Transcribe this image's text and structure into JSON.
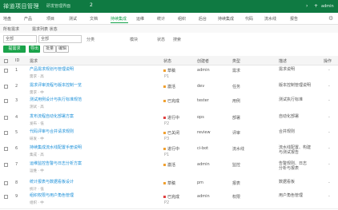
{
  "header": {
    "logo": "禅道项目管理",
    "system_name": "研发管理界面",
    "badge": "2",
    "right_icon_1": "›",
    "right_icon_2": "+",
    "user": "admin",
    "brand_color": "#0f7a42"
  },
  "menu": {
    "items": [
      {
        "label": "地盘"
      },
      {
        "label": "产品"
      },
      {
        "label": "项目"
      },
      {
        "label": "测试"
      },
      {
        "label": "文档"
      },
      {
        "label": "持续集成"
      },
      {
        "label": "运维"
      },
      {
        "label": "统计"
      },
      {
        "label": "组织"
      },
      {
        "label": "后台"
      },
      {
        "label": "持续集成"
      },
      {
        "label": "代码"
      },
      {
        "label": "流水线"
      },
      {
        "label": "报告"
      }
    ],
    "active_index": 5
  },
  "tabs": {
    "left": "所有需求",
    "right": "需求列表 状态"
  },
  "filters": {
    "select_1": "全部",
    "select_2": "全部",
    "text_1": "分类",
    "text_2": "模块",
    "text_3": "状态",
    "text_4": "搜索"
  },
  "buttons": {
    "primary": "提需求",
    "secondary": "导出",
    "outline_1": "批量",
    "outline_2": "编辑"
  },
  "table": {
    "headers": [
      "ID",
      "需求",
      "状态",
      "创建者",
      "类型",
      "描述",
      "操作"
    ],
    "rows": [
      {
        "num": "1",
        "title": "产品需求规划与管理说明",
        "sub": "需求 · 高",
        "status": "草稿",
        "status_sub": "P1",
        "status_color": "#f0a030",
        "c1": "admin",
        "c2": "需求",
        "desc": "需求说明",
        "desc2": ""
      },
      {
        "num": "2",
        "title": "需求评审流程与版本控制一览",
        "sub": "需求 · 中",
        "status": "激活",
        "status_sub": "",
        "status_color": "#f0a030",
        "c1": "dev",
        "c2": "任务",
        "desc": "版本控制管理说明",
        "desc2": ""
      },
      {
        "num": "3",
        "title": "测试用例设计与执行标准规范",
        "sub": "测试 · 高",
        "status": "已完成",
        "status_sub": "",
        "status_color": "#f0a030",
        "c1": "tester",
        "c2": "用例",
        "desc": "测试执行标准",
        "desc2": ""
      },
      {
        "num": "4",
        "title": "发布流程自动化部署方案",
        "sub": "发布 · 低",
        "status": "进行中",
        "status_sub": "P2",
        "status_color": "#e04040",
        "c1": "ops",
        "c2": "部署",
        "desc": "自动化部署",
        "desc2": ""
      },
      {
        "num": "5",
        "title": "代码评审与合并请求规则",
        "sub": "研发 · 中",
        "status": "已关闭",
        "status_sub": "P3",
        "status_color": "#f0a030",
        "c1": "review",
        "c2": "评审",
        "desc": "合并规则",
        "desc2": ""
      },
      {
        "num": "6",
        "title": "持续集成流水线配置手册说明",
        "sub": "集成 · 高",
        "status": "进行中",
        "status_sub": "P1",
        "status_color": "#f0a030",
        "c1": "ci-bot",
        "c2": "流水线",
        "desc": "流水线配置、构建",
        "desc2": "与测试报告"
      },
      {
        "num": "7",
        "title": "运维监控告警与日志分析方案",
        "sub": "运维 · 中",
        "status": "激活",
        "status_sub": "",
        "status_color": "#f0a030",
        "c1": "admin",
        "c2": "监控",
        "desc": "告警规则、日志",
        "desc2": "分析与报表"
      },
      {
        "num": "8",
        "title": "统计报表与数据看板设计",
        "sub": "统计 · 低",
        "status": "草稿",
        "status_sub": "",
        "status_color": "#f0a030",
        "c1": "pm",
        "c2": "报表",
        "desc": "数据看板",
        "desc2": ""
      },
      {
        "num": "9",
        "title": "组织权限与用户角色管理",
        "sub": "组织 · 中",
        "status": "已完成",
        "status_sub": "P2",
        "status_color": "#e04040",
        "c1": "admin",
        "c2": "权限",
        "desc": "用户角色管理",
        "desc2": ""
      }
    ]
  }
}
